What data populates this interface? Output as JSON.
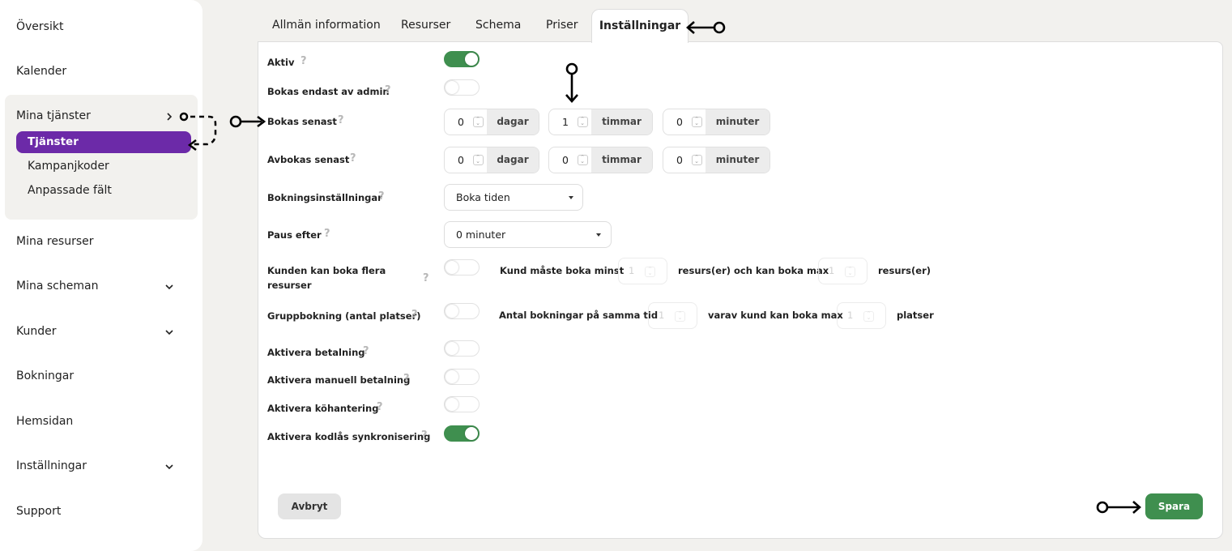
{
  "sidebar": {
    "items": {
      "oversikt": "Översikt",
      "kalender": "Kalender",
      "mina_tjanster": "Mina tjänster",
      "tjanster": "Tjänster",
      "kampanjkoder": "Kampanjkoder",
      "anpassade_falt": "Anpassade fält",
      "mina_resurser": "Mina resurser",
      "mina_scheman": "Mina scheman",
      "kunder": "Kunder",
      "bokningar": "Bokningar",
      "hemsidan": "Hemsidan",
      "installningar": "Inställningar",
      "support": "Support"
    }
  },
  "tabs": [
    "Allmän information",
    "Resurser",
    "Schema",
    "Priser",
    "Inställningar"
  ],
  "form": {
    "aktiv": {
      "label": "Aktiv",
      "on": true
    },
    "bokas_endast_admin": {
      "label": "Bokas endast av admin",
      "on": false
    },
    "bokas_senast": {
      "label": "Bokas senast",
      "dagar": "0",
      "timmar": "1",
      "minuter": "0"
    },
    "avbokas_senast": {
      "label": "Avbokas senast",
      "dagar": "0",
      "timmar": "0",
      "minuter": "0"
    },
    "units": {
      "dagar": "dagar",
      "timmar": "timmar",
      "minuter": "minuter"
    },
    "bokningsinstallningar": {
      "label": "Bokningsinställningar",
      "value": "Boka tiden"
    },
    "paus_efter": {
      "label": "Paus efter",
      "value": "0 minuter"
    },
    "flera_resurser": {
      "label_line1": "Kunden kan boka flera",
      "label_line2": "resurser",
      "on": false,
      "text_min": "Kund måste boka minst",
      "min_value": "1",
      "text_max": "resurs(er) och kan boka max",
      "max_value": "1",
      "text_end": "resurs(er)"
    },
    "gruppbokning": {
      "label": "Gruppbokning (antal platser)",
      "on": false,
      "text_antal": "Antal bokningar på samma tid",
      "antal_value": "1",
      "text_varav": "varav kund kan boka max",
      "varav_value": "1",
      "text_end": "platser"
    },
    "aktivera_betalning": {
      "label": "Aktivera betalning",
      "on": false
    },
    "aktivera_manuell_betalning": {
      "label": "Aktivera manuell betalning",
      "on": false
    },
    "aktivera_kohantering": {
      "label": "Aktivera köhantering",
      "on": false
    },
    "aktivera_kodlas": {
      "label": "Aktivera kodlås synkronisering",
      "on": true
    },
    "help": "?"
  },
  "buttons": {
    "cancel": "Avbryt",
    "save": "Spara"
  },
  "colors": {
    "accent_purple": "#6c2aa8",
    "toggle_green": "#3f8f4f",
    "save_green": "#3f8f4f"
  }
}
